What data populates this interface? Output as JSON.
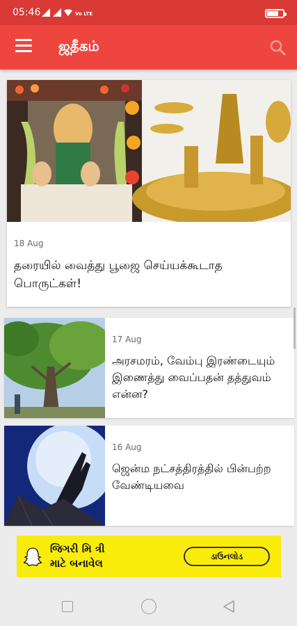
{
  "status_bar": {
    "time": "05:46",
    "network_label": "Vo LTE"
  },
  "app_bar": {
    "title": "ஜதீகம்"
  },
  "articles": [
    {
      "date": "18 Aug",
      "title": "தரையில் வைத்து பூஜை செய்யக்கூடாத பொருட்கள்!"
    },
    {
      "date": "17 Aug",
      "title": "அரசமரம், வேம்பு இரண்டையும் இணைத்து வைப்பதன் தத்துவம் என்ன?"
    },
    {
      "date": "16 Aug",
      "title": "ஜென்ம நட்சத்திரத்தில் பின்பற்ற வேண்டியவை"
    }
  ],
  "ad": {
    "headline_line1": "જિગરી મિ ત્રી",
    "headline_line2": "માટે બનાવેલ",
    "cta": "ડાઉનલોડ",
    "brand_color": "#f9ec0b"
  },
  "colors": {
    "status_bar": "#d93a35",
    "app_bar": "#ee463f"
  },
  "icons": {
    "menu": "hamburger-icon",
    "search": "search-icon",
    "ad_brand": "snapchat-ghost-icon"
  }
}
